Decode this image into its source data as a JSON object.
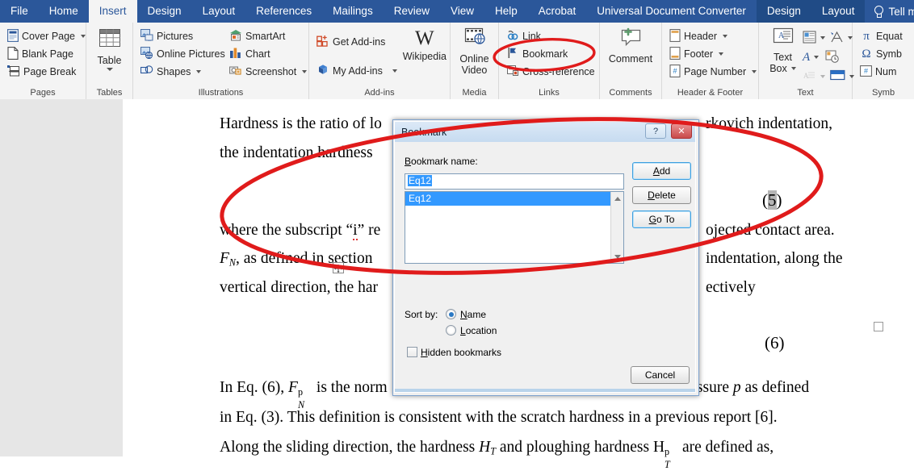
{
  "ribbon": {
    "tabs": [
      {
        "label": "File",
        "state": "normal"
      },
      {
        "label": "Home",
        "state": "normal"
      },
      {
        "label": "Insert",
        "state": "active"
      },
      {
        "label": "Design",
        "state": "normal"
      },
      {
        "label": "Layout",
        "state": "normal"
      },
      {
        "label": "References",
        "state": "normal"
      },
      {
        "label": "Mailings",
        "state": "normal"
      },
      {
        "label": "Review",
        "state": "normal"
      },
      {
        "label": "View",
        "state": "normal"
      },
      {
        "label": "Help",
        "state": "normal"
      },
      {
        "label": "Acrobat",
        "state": "normal"
      },
      {
        "label": "Universal Document Converter",
        "state": "normal"
      },
      {
        "label": "Design",
        "state": "contextual"
      },
      {
        "label": "Layout",
        "state": "contextual"
      }
    ],
    "tell_me": "Tell me what you",
    "groups": {
      "pages": {
        "label": "Pages",
        "items": [
          "Cover Page",
          "Blank Page",
          "Page Break"
        ]
      },
      "tables": {
        "label": "Tables",
        "button": "Table"
      },
      "illustrations": {
        "label": "Illustrations",
        "col1": [
          "Pictures",
          "Online Pictures",
          "Shapes"
        ],
        "col2": [
          "SmartArt",
          "Chart",
          "Screenshot"
        ]
      },
      "addins": {
        "label": "Add-ins",
        "col1": [
          "Get Add-ins",
          "My Add-ins"
        ],
        "wikipedia": "Wikipedia",
        "wikipedia_glyph": "W"
      },
      "media": {
        "label": "Media",
        "button_line1": "Online",
        "button_line2": "Video"
      },
      "links": {
        "label": "Links",
        "items": [
          "Link",
          "Bookmark",
          "Cross-reference"
        ]
      },
      "comments": {
        "label": "Comments",
        "button": "Comment"
      },
      "header_footer": {
        "label": "Header & Footer",
        "items": [
          "Header",
          "Footer",
          "Page Number"
        ]
      },
      "text": {
        "label": "Text",
        "button_line1": "Text",
        "button_line2": "Box"
      },
      "symbols": {
        "label": "Symb",
        "items": [
          "Equat",
          "Symb",
          "Num"
        ],
        "glyphs": [
          "π",
          "Ω",
          "#"
        ]
      }
    }
  },
  "dialog": {
    "title": "Bookmark",
    "help_glyph": "?",
    "close_glyph": "✕",
    "name_label": "Bookmark name:",
    "name_value": "Eq12",
    "list_items": [
      "Eq12"
    ],
    "buttons": {
      "add": "Add",
      "delete": "Delete",
      "goto": "Go To",
      "cancel": "Cancel"
    },
    "sort_by_label": "Sort by:",
    "sort_options": [
      {
        "label": "Name",
        "selected": true
      },
      {
        "label": "Location",
        "selected": false
      }
    ],
    "hidden_bookmarks_label": "Hidden bookmarks",
    "hidden_bookmarks_checked": false
  },
  "document": {
    "lines": {
      "l1a": "Hardness is the ratio of lo",
      "l1b": "rkovich indentation,",
      "l2a": "the indentation hardness ",
      "eq5_open": "(",
      "eq5_num": "5",
      "eq5_close": ")",
      "l3a": "where the subscript “",
      "l3a_sq": "i",
      "l3a_end": "” re",
      "l3b": "ojected contact area.",
      "l4a_sub": "N",
      "l4a": ", as defined in section",
      "l4b": "indentation, along the",
      "l5a": "vertical direction, the har",
      "l5b": "ectively",
      "eq6": "(6)",
      "l6a": "In Eq. (6), ",
      "l6a_tail": " is the norm",
      "l6b": " pressure ",
      "l6b_tail": " as defined",
      "l7": "in Eq. (3). This definition is consistent with the scratch hardness in a previous report [6].",
      "l8a": "Along the sliding direction, the hardness ",
      "l8a_mid": " and ploughing hardness H",
      "l8a_tail": " are defined as,"
    }
  },
  "annotations": {
    "ellipse_color": "#e01b1b",
    "ellipse_bookmark_target": "Bookmark",
    "ellipse_document_target": "equation-region"
  }
}
